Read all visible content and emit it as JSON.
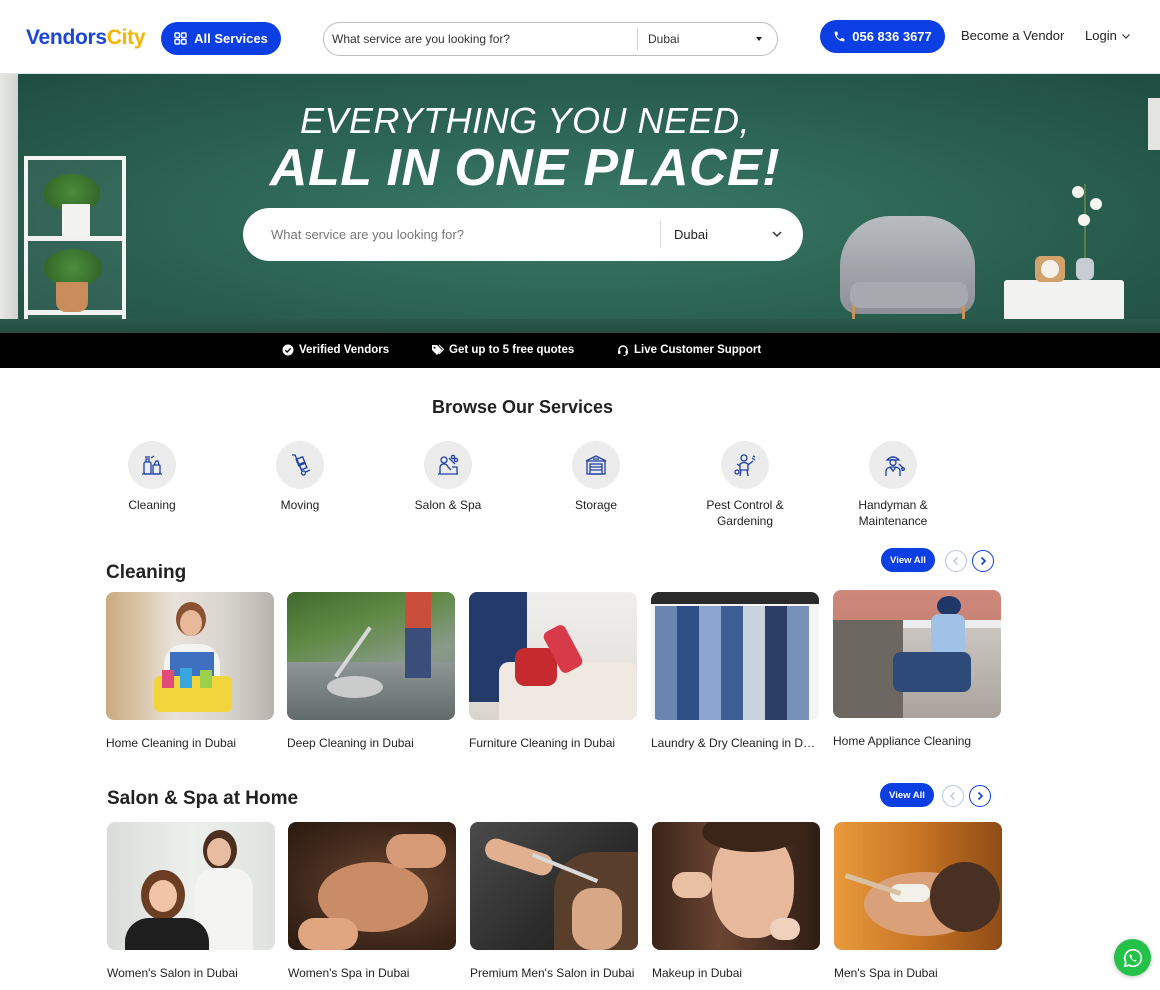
{
  "header": {
    "logo_part1": "Vendors",
    "logo_part2": "City",
    "all_services_label": "All Services",
    "search_placeholder": "What service are you looking for?",
    "city": "Dubai",
    "phone": "056 836 3677",
    "become_vendor": "Become a Vendor",
    "login": "Login"
  },
  "hero": {
    "line1": "EVERYTHING YOU NEED,",
    "line2": "ALL IN ONE PLACE!",
    "search_placeholder": "What service are you looking for?",
    "city": "Dubai"
  },
  "features": [
    {
      "label": "Verified Vendors",
      "icon": "check-circle-icon"
    },
    {
      "label": "Get up to 5 free quotes",
      "icon": "tags-icon"
    },
    {
      "label": "Live Customer Support",
      "icon": "headset-icon"
    }
  ],
  "browse": {
    "title": "Browse Our Services",
    "categories": [
      {
        "label": "Cleaning",
        "icon": "cleaning-icon"
      },
      {
        "label": "Moving",
        "icon": "hand-truck-icon"
      },
      {
        "label": "Salon & Spa",
        "icon": "salon-icon"
      },
      {
        "label": "Storage",
        "icon": "storage-icon"
      },
      {
        "label": "Pest Control & Gardening",
        "icon": "pest-control-icon"
      },
      {
        "label": "Handyman & Maintenance",
        "icon": "handyman-icon"
      }
    ]
  },
  "sections": [
    {
      "title": "Cleaning",
      "view_all": "View All",
      "cards": [
        {
          "caption": "Home Cleaning in Dubai"
        },
        {
          "caption": "Deep Cleaning in Dubai"
        },
        {
          "caption": "Furniture Cleaning in Dubai"
        },
        {
          "caption": "Laundry & Dry Cleaning in Dubai"
        },
        {
          "caption": "Home Appliance Cleaning"
        }
      ]
    },
    {
      "title": "Salon & Spa at Home",
      "view_all": "View All",
      "cards": [
        {
          "caption": "Women's Salon in Dubai"
        },
        {
          "caption": "Women's Spa in Dubai"
        },
        {
          "caption": "Premium Men's Salon in Dubai"
        },
        {
          "caption": "Makeup in Dubai"
        },
        {
          "caption": "Men's Spa in Dubai"
        }
      ]
    }
  ],
  "colors": {
    "brand_blue": "#0b3ee3",
    "logo_yellow": "#f4b400",
    "whatsapp_green": "#25c24a"
  }
}
